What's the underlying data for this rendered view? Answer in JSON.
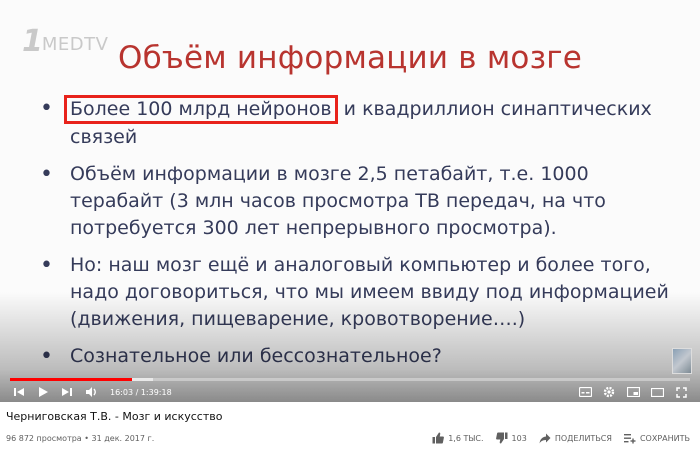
{
  "logo": {
    "one": "1",
    "text": "MEDTV"
  },
  "slide": {
    "title": "Объём информации в мозге",
    "bullet1_highlight": "Более 100 млрд нейронов",
    "bullet1_rest": " и  квадриллион синаптических связей",
    "bullet2": "Объём информации в мозге 2,5 петабайт, т.е. 1000 терабайт  (3 млн часов просмотра ТВ передач, на что потребуется 300 лет непрерывного просмотра).",
    "bullet3": "Но:  наш мозг ещё и аналоговый компьютер   и более того, надо договориться, что мы имеем ввиду под информацией (движения, пищеварение, кровотворение….)",
    "bullet4": "Сознательное или бессознательное?",
    "bullet_glyph": "•"
  },
  "player": {
    "current_time": "16:03",
    "duration": "1:39:18",
    "time_separator": " / ",
    "progress_fraction": 0.18,
    "accent_color": "#ff0000"
  },
  "video": {
    "title": "Черниговская Т.В. - Мозг и искусство",
    "views": "96 872 просмотра",
    "separator": " • ",
    "date": "31 дек. 2017 г.",
    "likes": "1,6 тыс.",
    "dislikes": "103",
    "share_label": "Поделиться",
    "save_label": "Сохранить"
  }
}
